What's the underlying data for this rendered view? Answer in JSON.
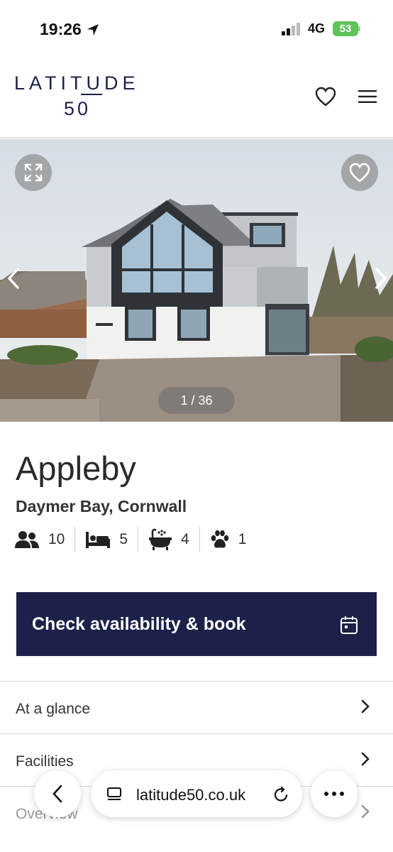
{
  "status_bar": {
    "time": "19:26",
    "network": "4G",
    "battery": "53"
  },
  "header": {
    "logo_top": "LATITUDE",
    "logo_bottom": "50"
  },
  "gallery": {
    "counter": "1 / 36"
  },
  "property": {
    "name": "Appleby",
    "location": "Daymer Bay, Cornwall",
    "amenities": [
      {
        "icon": "guests-icon",
        "value": "10"
      },
      {
        "icon": "bed-icon",
        "value": "5"
      },
      {
        "icon": "bath-icon",
        "value": "4"
      },
      {
        "icon": "paw-icon",
        "value": "1"
      }
    ]
  },
  "book": {
    "label": "Check availability & book",
    "icon": "calendar-icon"
  },
  "sections": [
    "At a glance",
    "Facilities",
    "Overview"
  ],
  "browser": {
    "url": "latitude50.co.uk"
  },
  "colors": {
    "brand_navy": "#1b2148",
    "battery_green": "#5fc25a"
  }
}
